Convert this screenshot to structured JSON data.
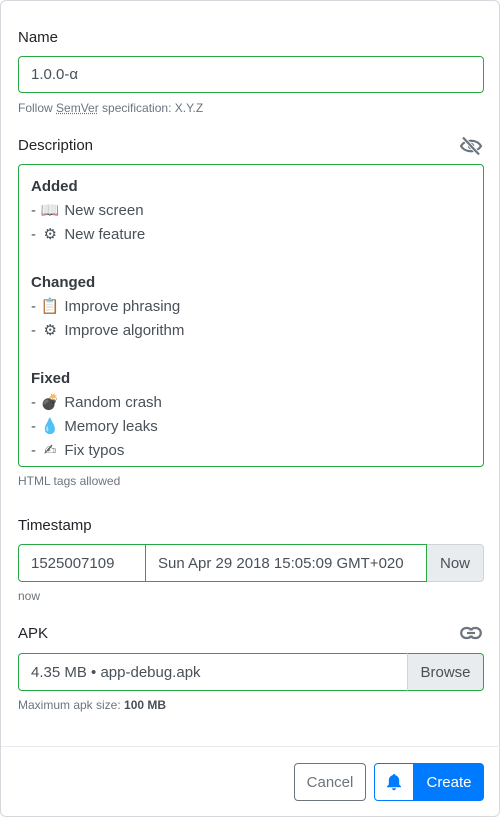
{
  "name": {
    "label": "Name",
    "value": "1.0.0-α",
    "help_prefix": "Follow ",
    "help_abbr": "SemVer",
    "help_suffix": " specification: X.Y.Z"
  },
  "description": {
    "label": "Description",
    "toggle_icon": "eye-slash-icon",
    "sections": [
      {
        "heading": "Added",
        "items": [
          {
            "emoji": "📖",
            "text": "New screen"
          },
          {
            "emoji": "⚙",
            "text": "New feature"
          }
        ]
      },
      {
        "heading": "Changed",
        "items": [
          {
            "emoji": "📋",
            "text": "Improve phrasing"
          },
          {
            "emoji": "⚙",
            "text": "Improve algorithm"
          }
        ]
      },
      {
        "heading": "Fixed",
        "items": [
          {
            "emoji": "💣",
            "text": "Random crash"
          },
          {
            "emoji": "💧",
            "text": "Memory leaks"
          },
          {
            "emoji": "✍",
            "text": "Fix typos"
          }
        ]
      }
    ],
    "help": "HTML tags allowed"
  },
  "timestamp": {
    "label": "Timestamp",
    "unix_value": "1525007109",
    "date_value": "Sun Apr 29 2018 15:05:09 GMT+020",
    "now_button": "Now",
    "help": "now"
  },
  "apk": {
    "label": "APK",
    "link_icon": "link-icon",
    "value": "4.35 MB • app-debug.apk",
    "browse_button": "Browse",
    "help_prefix": "Maximum apk size: ",
    "help_value": "100 MB"
  },
  "footer": {
    "cancel_label": "Cancel",
    "notify_icon": "bell-icon",
    "create_label": "Create"
  },
  "colors": {
    "valid_border": "#28a745",
    "primary": "#007bff",
    "secondary": "#6c757d"
  }
}
